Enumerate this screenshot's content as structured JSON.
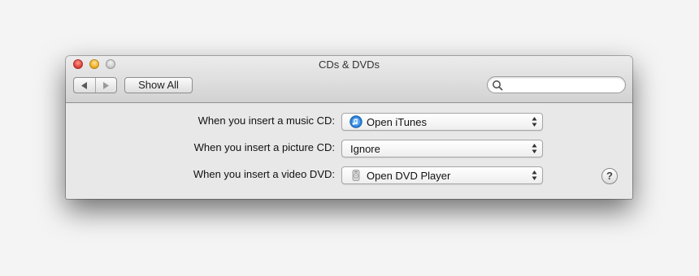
{
  "window": {
    "title": "CDs & DVDs",
    "traffic_lights": [
      "close-button",
      "minimize-button",
      "zoom-button"
    ]
  },
  "toolbar": {
    "back_icon": "triangle-left-icon",
    "forward_icon": "triangle-right-icon",
    "show_all_label": "Show All",
    "search": {
      "value": "",
      "placeholder": "",
      "icon": "magnifier-icon"
    }
  },
  "rows": [
    {
      "label": "When you insert a music CD:",
      "value": "Open iTunes",
      "icon": "itunes-icon"
    },
    {
      "label": "When you insert a picture CD:",
      "value": "Ignore",
      "icon": ""
    },
    {
      "label": "When you insert a video DVD:",
      "value": "Open DVD Player",
      "icon": "dvd-player-icon"
    }
  ],
  "help_label": "?",
  "colors": {
    "close": "#e0443e",
    "minimize": "#f2b22c",
    "zoom": "#cfcfcf",
    "itunes_blue": "#2d7fd6"
  }
}
